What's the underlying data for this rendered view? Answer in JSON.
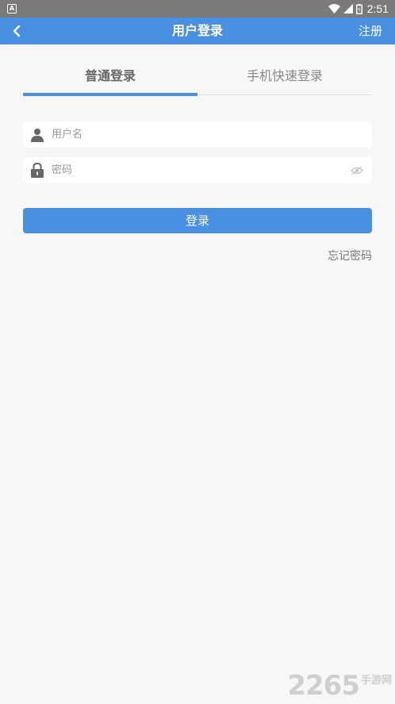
{
  "status_bar": {
    "time": "2:51",
    "notification_icon": "a-icon"
  },
  "app_bar": {
    "title": "用户登录",
    "register_label": "注册",
    "back_icon": "chevron-left-icon"
  },
  "tabs": [
    {
      "label": "普通登录",
      "active": true
    },
    {
      "label": "手机快速登录",
      "active": false
    }
  ],
  "form": {
    "username": {
      "value": "",
      "placeholder": "用户名",
      "icon": "user-icon"
    },
    "password": {
      "value": "",
      "placeholder": "密码",
      "icon": "lock-icon"
    },
    "login_label": "登录",
    "forgot_label": "忘记密码"
  },
  "watermark": {
    "number": "2265",
    "text": "手游网"
  },
  "colors": {
    "primary": "#4a90e2",
    "background": "#f7f7f7",
    "status_bar": "#7a7a7a"
  }
}
